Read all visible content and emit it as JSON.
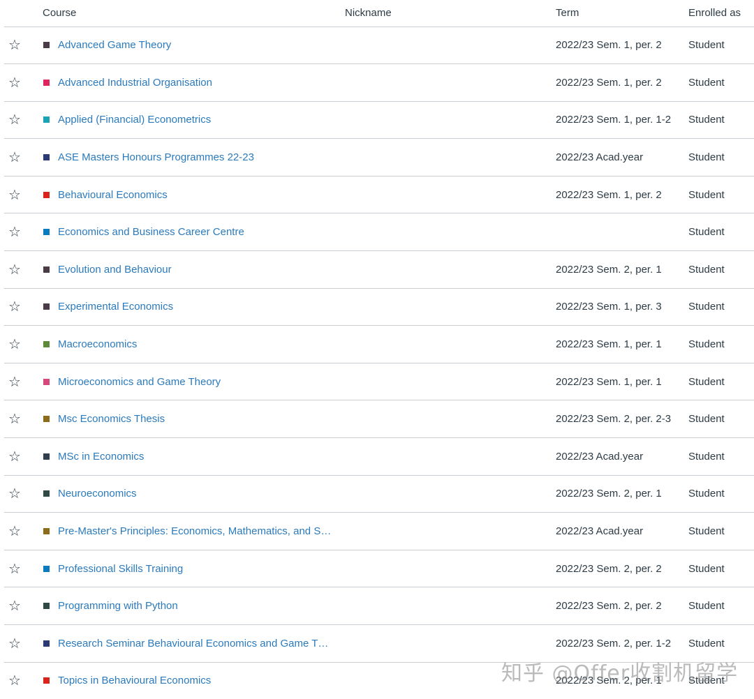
{
  "table": {
    "headers": {
      "course": "Course",
      "nickname": "Nickname",
      "term": "Term",
      "enrolled_as": "Enrolled as"
    },
    "star_glyph": "☆",
    "rows": [
      {
        "course": "Advanced Game Theory",
        "color": "#4a3b47",
        "nickname": "",
        "term": "2022/23 Sem. 1, per. 2",
        "enrolled_as": "Student"
      },
      {
        "course": "Advanced Industrial Organisation",
        "color": "#e0245e",
        "nickname": "",
        "term": "2022/23 Sem. 1, per. 2",
        "enrolled_as": "Student"
      },
      {
        "course": "Applied (Financial) Econometrics",
        "color": "#1aa3b5",
        "nickname": "",
        "term": "2022/23 Sem. 1, per. 1-2",
        "enrolled_as": "Student"
      },
      {
        "course": "ASE Masters Honours Programmes 22-23",
        "color": "#2b3a73",
        "nickname": "",
        "term": "2022/23 Acad.year",
        "enrolled_as": "Student"
      },
      {
        "course": "Behavioural Economics",
        "color": "#d9241b",
        "nickname": "",
        "term": "2022/23 Sem. 1, per. 2",
        "enrolled_as": "Student"
      },
      {
        "course": "Economics and Business Career Centre",
        "color": "#0b7bbf",
        "nickname": "",
        "term": "",
        "enrolled_as": "Student"
      },
      {
        "course": "Evolution and Behaviour",
        "color": "#4a3b47",
        "nickname": "",
        "term": "2022/23 Sem. 2, per. 1",
        "enrolled_as": "Student"
      },
      {
        "course": "Experimental Economics",
        "color": "#4a3b47",
        "nickname": "",
        "term": "2022/23 Sem. 1, per. 3",
        "enrolled_as": "Student"
      },
      {
        "course": "Macroeconomics",
        "color": "#5a8a3a",
        "nickname": "",
        "term": "2022/23 Sem. 1, per. 1",
        "enrolled_as": "Student"
      },
      {
        "course": "Microeconomics and Game Theory",
        "color": "#d6477a",
        "nickname": "",
        "term": "2022/23 Sem. 1, per. 1",
        "enrolled_as": "Student"
      },
      {
        "course": "Msc Economics Thesis",
        "color": "#8c6c1a",
        "nickname": "",
        "term": "2022/23 Sem. 2, per. 2-3",
        "enrolled_as": "Student"
      },
      {
        "course": "MSc in Economics",
        "color": "#2f3f4d",
        "nickname": "",
        "term": "2022/23 Acad.year",
        "enrolled_as": "Student"
      },
      {
        "course": "Neuroeconomics",
        "color": "#2f4a44",
        "nickname": "",
        "term": "2022/23 Sem. 2, per. 1",
        "enrolled_as": "Student"
      },
      {
        "course": "Pre-Master's Principles: Economics, Mathematics, and Statistics",
        "color": "#8c6c1a",
        "nickname": "",
        "term": "2022/23 Acad.year",
        "enrolled_as": "Student"
      },
      {
        "course": "Professional Skills Training",
        "color": "#0b7bbf",
        "nickname": "",
        "term": "2022/23 Sem. 2, per. 2",
        "enrolled_as": "Student"
      },
      {
        "course": "Programming with Python",
        "color": "#2f4a44",
        "nickname": "",
        "term": "2022/23 Sem. 2, per. 2",
        "enrolled_as": "Student"
      },
      {
        "course": "Research Seminar Behavioural Economics and Game Theory",
        "color": "#2b3a73",
        "nickname": "",
        "term": "2022/23 Sem. 2, per. 1-2",
        "enrolled_as": "Student"
      },
      {
        "course": "Topics in Behavioural Economics",
        "color": "#d9241b",
        "nickname": "",
        "term": "2022/23 Sem. 2, per. 1",
        "enrolled_as": "Student"
      }
    ]
  },
  "watermark": "知乎 @Offer收割机留学"
}
